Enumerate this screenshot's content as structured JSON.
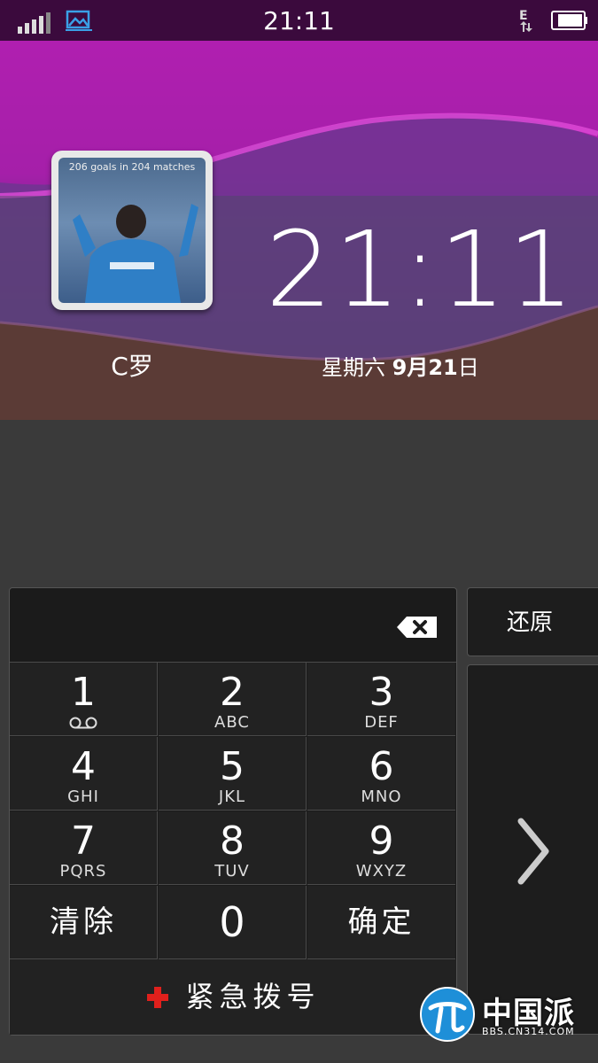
{
  "status_bar": {
    "time": "21:11",
    "network_type": "E",
    "icons": [
      "signal-icon",
      "gallery-icon",
      "network-e-icon",
      "battery-icon"
    ]
  },
  "lockscreen": {
    "photo_caption": "206 goals in 204 matches",
    "contact_name": "C罗",
    "clock": "21:11",
    "date_weekday": "星期六",
    "date_month": "9月",
    "date_day": "21",
    "date_suffix": "日"
  },
  "keypad": {
    "keys": [
      {
        "num": "1",
        "letters": ""
      },
      {
        "num": "2",
        "letters": "ABC"
      },
      {
        "num": "3",
        "letters": "DEF"
      },
      {
        "num": "4",
        "letters": "GHI"
      },
      {
        "num": "5",
        "letters": "JKL"
      },
      {
        "num": "6",
        "letters": "MNO"
      },
      {
        "num": "7",
        "letters": "PQRS"
      },
      {
        "num": "8",
        "letters": "TUV"
      },
      {
        "num": "9",
        "letters": "WXYZ"
      }
    ],
    "clear_label": "清除",
    "zero": "0",
    "confirm_label": "确定",
    "emergency_label": "紧急拨号"
  },
  "side": {
    "restore_label": "还原"
  },
  "watermark": {
    "title": "中国派",
    "subtitle": "BBS.CN314.COM"
  }
}
